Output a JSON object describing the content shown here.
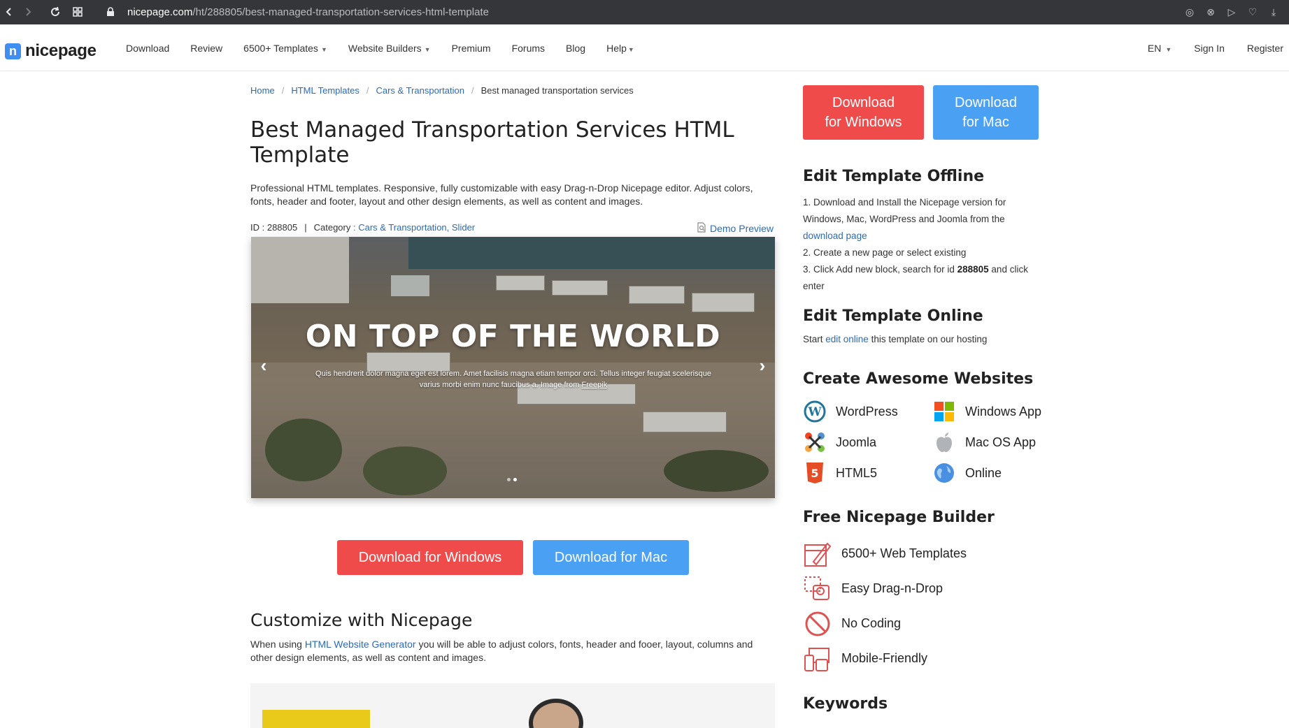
{
  "browser": {
    "url_host": "nicepage.com",
    "url_path": "/ht/288805/best-managed-transportation-services-html-template"
  },
  "header": {
    "logo_text": "nicepage",
    "logo_mark": "n",
    "menu": [
      {
        "label": "Download"
      },
      {
        "label": "Review"
      },
      {
        "label": "6500+ Templates",
        "caret": true
      },
      {
        "label": "Website Builders",
        "caret": true
      },
      {
        "label": "Premium"
      },
      {
        "label": "Forums"
      },
      {
        "label": "Blog"
      },
      {
        "label": "Help",
        "caret": true
      }
    ],
    "lang": "EN",
    "sign_in": "Sign In",
    "register": "Register"
  },
  "breadcrumb": {
    "items": [
      "Home",
      "HTML Templates",
      "Cars & Transportation"
    ],
    "current": "Best managed transportation services"
  },
  "title": "Best Managed Transportation Services HTML Template",
  "intro": "Professional HTML templates. Responsive, fully customizable with easy Drag-n-Drop Nicepage editor. Adjust colors, fonts, header and footer, layout and other design elements, as well as content and images.",
  "meta": {
    "id_label": "ID : 288805",
    "category_label": "Category",
    "category_sep": " : ",
    "categories": [
      "Cars & Transportation",
      "Slider"
    ],
    "category_comma": ", ",
    "demo_preview": "Demo Preview"
  },
  "slider": {
    "headline": "ON TOP OF THE WORLD",
    "sub_text": "Quis hendrerit dolor magna eget est lorem. Amet facilisis magna etiam tempor orci. Tellus integer feugiat scelerisque varius morbi enim nunc faucibus a. Image from",
    "sub_link": "Freepik",
    "prev": "‹",
    "next": "›"
  },
  "buttons": {
    "download_windows": "Download for Windows",
    "download_mac": "Download for Mac",
    "side_windows_line1": "Download",
    "side_windows_line2": "for Windows",
    "side_mac_line1": "Download",
    "side_mac_line2": "for Mac"
  },
  "customize": {
    "heading": "Customize with Nicepage",
    "text_before": "When using ",
    "link": "HTML Website Generator",
    "text_after": " you will be able to adjust colors, fonts, header and fooer, layout, columns and other design elements, as well as content and images."
  },
  "sidebar": {
    "offline_heading": "Edit Template Offline",
    "step1_text": "1. Download and Install the Nicepage version for Windows, Mac, WordPress and Joomla from the ",
    "step1_link": "download page",
    "step2": "2. Create a new page or select existing",
    "step3_before": "3. Click Add new block, search for id ",
    "step3_id": "288805",
    "step3_after": " and click enter",
    "online_heading": "Edit Template Online",
    "online_before": "Start ",
    "online_link": "edit online",
    "online_after": " this template on our hosting",
    "websites_heading": "Create Awesome Websites",
    "platforms": [
      {
        "label": "WordPress",
        "icon": "wordpress-icon"
      },
      {
        "label": "Windows App",
        "icon": "windows-icon"
      },
      {
        "label": "Joomla",
        "icon": "joomla-icon"
      },
      {
        "label": "Mac OS App",
        "icon": "apple-icon"
      },
      {
        "label": "HTML5",
        "icon": "html5-icon"
      },
      {
        "label": "Online",
        "icon": "globe-icon"
      }
    ],
    "builder_heading": "Free Nicepage Builder",
    "features": [
      {
        "label": "6500+ Web Templates",
        "icon": "templates-icon"
      },
      {
        "label": "Easy Drag-n-Drop",
        "icon": "drag-drop-icon"
      },
      {
        "label": "No Coding",
        "icon": "no-coding-icon"
      },
      {
        "label": "Mobile-Friendly",
        "icon": "mobile-friendly-icon"
      }
    ],
    "keywords_heading": "Keywords"
  },
  "colors": {
    "red": "#ef4b4b",
    "blue": "#4aa0f2",
    "link": "#2a6bb8"
  }
}
